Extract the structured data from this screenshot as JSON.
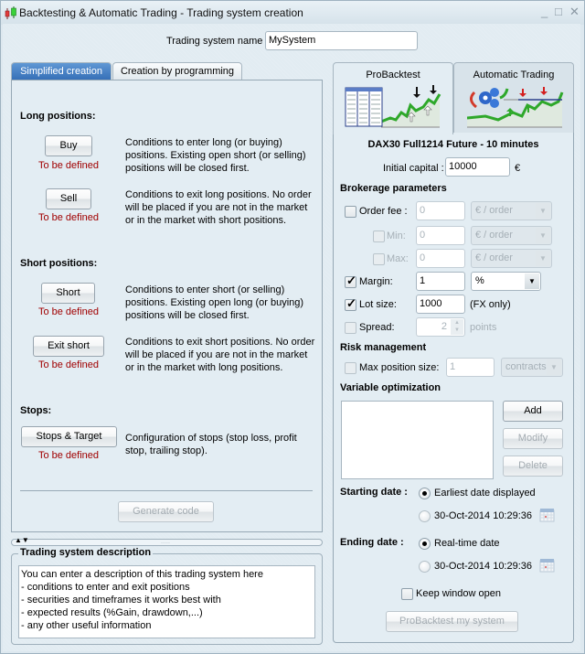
{
  "window": {
    "title": "Backtesting & Automatic Trading - Trading system creation",
    "controls": {
      "minimize": "_",
      "maximize": "□",
      "close": "✕"
    }
  },
  "system_name": {
    "label": "Trading system name",
    "value": "MySystem"
  },
  "left_tabs": [
    {
      "label": "Simplified creation",
      "active": true
    },
    {
      "label": "Creation by programming",
      "active": false
    }
  ],
  "long_positions": {
    "title": "Long positions:",
    "buy": {
      "label": "Buy",
      "status": "To be defined",
      "description": "Conditions to enter long (or buying) positions. Existing open short (or selling) positions will be closed first."
    },
    "sell": {
      "label": "Sell",
      "status": "To be defined",
      "description": "Conditions to exit long positions. No order will be placed if you are not in the market or in the market with short positions."
    }
  },
  "short_positions": {
    "title": "Short positions:",
    "short": {
      "label": "Short",
      "status": "To be defined",
      "description": "Conditions to enter short (or selling) positions. Existing open long (or buying) positions will be closed first."
    },
    "exit_short": {
      "label": "Exit short",
      "status": "To be defined",
      "description": "Conditions to exit short positions. No order will be placed if you are not in the market or in the market with long positions."
    }
  },
  "stops": {
    "title": "Stops:",
    "stops_target": {
      "label": "Stops & Target",
      "status": "To be defined",
      "description": "Configuration of stops (stop loss, profit stop, trailing stop)."
    }
  },
  "generate_code": {
    "label": "Generate code",
    "enabled": false
  },
  "splitter": {
    "arrows": "▲▼",
    "grip": "·····"
  },
  "description_box": {
    "title": "Trading system description",
    "lines": [
      "You can enter a description of this trading system here",
      "- conditions to enter and exit positions",
      "- securities and timeframes it works best with",
      "- expected results (%Gain, drawdown,...)",
      "- any other useful information"
    ]
  },
  "right_tabs": [
    {
      "label": "ProBacktest",
      "active": true,
      "icon": "backtest-chart-icon"
    },
    {
      "label": "Automatic Trading",
      "active": false,
      "icon": "auto-trading-chart-icon"
    }
  ],
  "instrument": "DAX30  Full1214 Future - 10 minutes",
  "initial_capital": {
    "label": "Initial capital :",
    "value": "10000",
    "currency": "€"
  },
  "brokerage": {
    "title": "Brokerage parameters",
    "order_fee": {
      "label": "Order fee :",
      "checked": false,
      "value": "0",
      "unit": "€ / order"
    },
    "min": {
      "label": "Min:",
      "checked": false,
      "value": "0",
      "unit": "€ / order"
    },
    "max": {
      "label": "Max:",
      "checked": false,
      "value": "0",
      "unit": "€ / order"
    },
    "margin": {
      "label": "Margin:",
      "checked": true,
      "value": "1",
      "unit": "%"
    },
    "lot_size": {
      "label": "Lot size:",
      "checked": true,
      "value": "1000",
      "note": "(FX only)"
    },
    "spread": {
      "label": "Spread:",
      "checked": false,
      "value": "2",
      "unit": "points"
    }
  },
  "risk": {
    "title": "Risk management",
    "max_position": {
      "label": "Max position size:",
      "checked": false,
      "value": "1",
      "unit": "contracts"
    }
  },
  "optimization": {
    "title": "Variable optimization",
    "items": [],
    "add": "Add",
    "modify": "Modify",
    "delete": "Delete"
  },
  "starting_date": {
    "label": "Starting date :",
    "options": [
      {
        "label": "Earliest date displayed",
        "selected": true
      },
      {
        "label": "30-Oct-2014 10:29:36",
        "selected": false
      }
    ]
  },
  "ending_date": {
    "label": "Ending date :",
    "options": [
      {
        "label": "Real-time date",
        "selected": true
      },
      {
        "label": "30-Oct-2014 10:29:36",
        "selected": false
      }
    ]
  },
  "keep_window_open": {
    "label": "Keep window open",
    "checked": false
  },
  "run_button": {
    "label": "ProBacktest my system",
    "enabled": false
  },
  "colors": {
    "active_tab": "#3670b8",
    "tbd": "#a00000",
    "chart_line": "#2ea82a"
  }
}
